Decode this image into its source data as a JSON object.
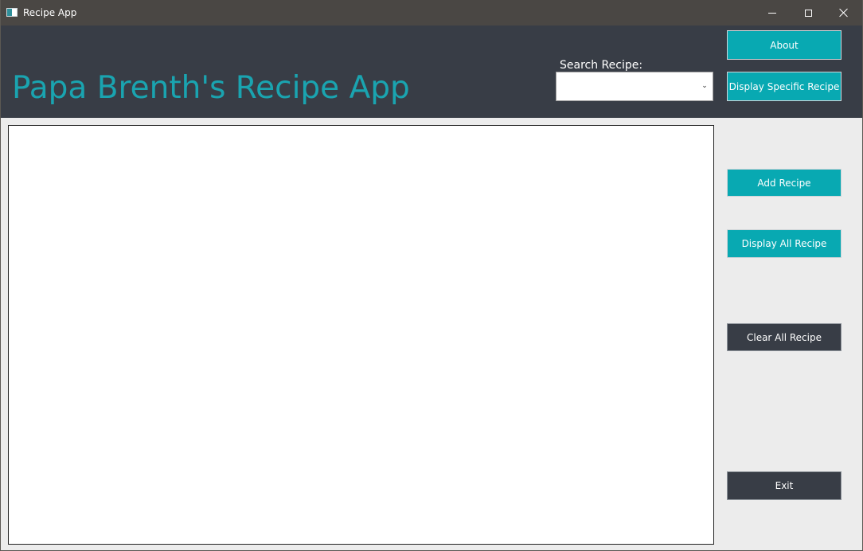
{
  "window": {
    "title": "Recipe App"
  },
  "header": {
    "app_title": "Papa Brenth's Recipe App",
    "search_label": "Search Recipe:",
    "search_value": ""
  },
  "buttons": {
    "about": "About",
    "display_specific": "Display Specific Recipe",
    "add": "Add Recipe",
    "display_all": "Display All Recipe",
    "clear_all": "Clear All Recipe",
    "exit": "Exit"
  },
  "icons": {
    "app": "app-window-icon",
    "minimize": "minimize-icon",
    "maximize": "maximize-icon",
    "close": "close-icon",
    "dropdown": "chevron-down-icon"
  },
  "colors": {
    "header_bg": "#383d46",
    "accent_teal": "#08a9b2",
    "title_teal": "#1aa4b0",
    "dark_button": "#383d46",
    "titlebar_bg": "#4a4744",
    "body_bg": "#ececec"
  }
}
